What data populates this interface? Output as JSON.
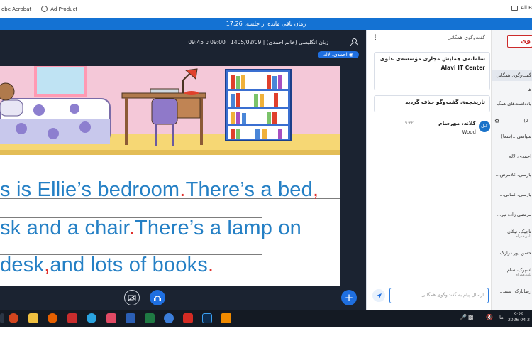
{
  "browser": {
    "bookmarks": [
      "obe Acrobat",
      "Ad Product"
    ],
    "right_folder": "All B"
  },
  "session": {
    "remaining": "زمان باقی مانده از جلسه: 17:26"
  },
  "classroom": {
    "info": "زبان انگلیسی (خانم احمدی) | 1405/02/09 | 09:00 تا 09:45",
    "presenter": "احمدی، لاله"
  },
  "slide": {
    "lines": [
      {
        "text": "s is Ellie’s bedroom",
        "punct": ".",
        "rest": "There’s a bed",
        "end": ","
      },
      {
        "text": "sk and a chair",
        "punct": ".",
        "rest": "There’s a lamp on",
        "end": ""
      },
      {
        "text": "desk",
        "punct": ",",
        "rest": "and lots of books",
        "end": "."
      }
    ]
  },
  "chat": {
    "title": "گفت‌وگوی همگانی",
    "pinned_title": "سامانه‌ی همایش مجازی مؤسسه‌ی علوی",
    "pinned_org": "Alavi IT Center",
    "history_deleted": "تاریخچه‌ی گفت‌وگو حذف گردید",
    "message": {
      "avatar": "ک‌ل",
      "name": "کلانه، مهرسام",
      "time": "۹:۲۲",
      "text": "Wood"
    },
    "input_placeholder": "ارسال پیام به گفت‌وگوی همگانی"
  },
  "participants": {
    "logo": "وی",
    "tab": "گفت‌وگوی همگانی",
    "notes_label": "یادداشت‌های همگ",
    "users_count": "(2",
    "rows": [
      {
        "name": "سیاسی...(شما)",
        "sub": ""
      },
      {
        "name": "احمدی، لاله",
        "sub": ""
      },
      {
        "name": "پارسی، غلامرض...",
        "sub": ""
      },
      {
        "name": "پارسی، کمالی...",
        "sub": ""
      },
      {
        "name": "مرتضی زاده نیر...",
        "sub": ""
      },
      {
        "name": "تاجیک، نیکان",
        "sub": "تلفن‌همراه"
      },
      {
        "name": "حسن پور درازک...",
        "sub": ""
      },
      {
        "name": "اسپرک، سام",
        "sub": "تلفن‌همراه"
      },
      {
        "name": "رضایارک، سید...",
        "sub": ""
      }
    ]
  },
  "taskbar": {
    "time": "9:29",
    "date": "2026-04-2",
    "lang": "ما"
  },
  "colors": {
    "accent": "#1472d3",
    "text_blue": "#2580c5",
    "punct_red": "#e0302c",
    "dark_panel": "#1b2331"
  }
}
